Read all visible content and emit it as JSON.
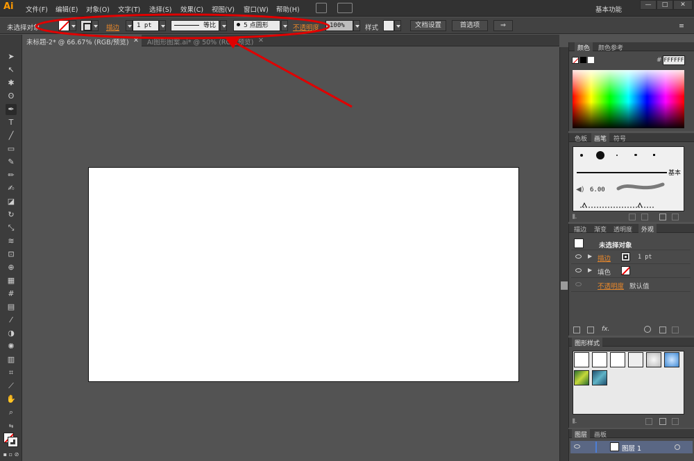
{
  "app": {
    "logo": "Ai"
  },
  "menu": [
    "文件(F)",
    "编辑(E)",
    "对象(O)",
    "文字(T)",
    "选择(S)",
    "效果(C)",
    "视图(V)",
    "窗口(W)",
    "帮助(H)"
  ],
  "workspace": "基本功能",
  "window_controls": {
    "minimize": "—",
    "restore": "□",
    "close": "✕"
  },
  "control_bar": {
    "selection_status": "未选择对象",
    "stroke_label": "描边",
    "stroke_weight": "1 pt",
    "stroke_profile": "等比",
    "brush": "5 点圆形",
    "opacity_label": "不透明度",
    "opacity_value": "100%",
    "style_label": "样式",
    "doc_setup": "文档设置",
    "preferences": "首选项"
  },
  "tabs": [
    {
      "label": "未标题-2* @ 66.67% (RGB/预览)",
      "close": "✕"
    },
    {
      "label": "AI图形图案.ai* @ 50% (RGB/预览)",
      "close": "✕"
    }
  ],
  "color_panel": {
    "tabs": [
      "颜色",
      "颜色参考"
    ],
    "hex_label": "#",
    "hex_value": "FFFFFF"
  },
  "brush_panel": {
    "tabs": [
      "色板",
      "画笔",
      "符号"
    ],
    "basic_label": "基本",
    "size_label": "6.00"
  },
  "appearance_panel": {
    "tabs": [
      "描边",
      "渐变",
      "透明度",
      "外观"
    ],
    "title": "未选择对象",
    "rows": [
      {
        "label": "描边",
        "value": "1 pt"
      },
      {
        "label": "填色",
        "value": ""
      },
      {
        "label": "不透明度",
        "value": "默认值"
      }
    ],
    "fx": "fx."
  },
  "graphic_styles_panel": {
    "tabs": [
      "图形样式"
    ]
  },
  "layers_panel": {
    "tabs": [
      "图层",
      "画板"
    ],
    "layer_name": "图层 1"
  },
  "colors": {
    "accent_link": "#e5862b",
    "annotation": "#e00000",
    "artboard": "#ffffff"
  }
}
